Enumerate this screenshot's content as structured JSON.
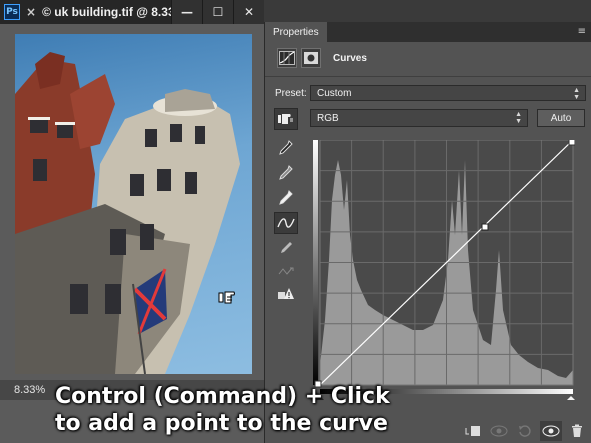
{
  "document": {
    "app_logo": "Ps",
    "close_glyph": "×",
    "title": "© uk building.tif @ 8.33...",
    "window_buttons": [
      "—",
      "☐",
      "✕"
    ],
    "zoom": "8.33%"
  },
  "properties": {
    "tab_label": "Properties",
    "panel_title": "Curves",
    "preset_label": "Preset:",
    "preset_value": "Custom",
    "channel_value": "RGB",
    "auto_label": "Auto"
  },
  "caption": {
    "line1": "Control (Command) + Click",
    "line2": "to add a point to the curve"
  },
  "icons": {
    "sidebar": [
      "target-adjust-icon",
      "sample-black-eyedropper-icon",
      "sample-gray-eyedropper-icon",
      "sample-white-eyedropper-icon",
      "edit-points-curve-icon",
      "draw-pencil-icon",
      "smooth-curve-icon",
      "clipping-warning-icon"
    ],
    "bottom": [
      "clip-to-layer-icon",
      "view-previous-icon",
      "reset-icon",
      "visibility-eye-icon",
      "trash-icon"
    ]
  },
  "colors": {
    "panel_bg": "#535353",
    "title_bar": "#262626",
    "histogram": "#9a9a9a",
    "sky": "#6ea6d3"
  }
}
